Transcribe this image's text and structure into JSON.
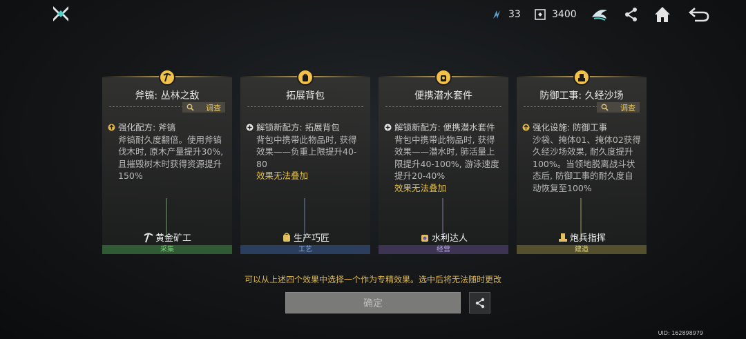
{
  "topbar": {
    "logo_icon": "crossed-blades-logo",
    "energy_count": "33",
    "coin_count": "3400"
  },
  "cards": [
    {
      "title": "斧镐: 丛林之敌",
      "investigate": "调查",
      "prefix": "强化配方: 斧镐",
      "body": "斧镐耐久度翻倍。使用斧镐伐木时, 原木产量提升30%, 且摧毁树木时获得资源提升150%",
      "warn": "",
      "role": "黄金矿工",
      "category": "采集",
      "category_color": "#2f5a34",
      "category_text_color": "#7ecf7c"
    },
    {
      "title": "拓展背包",
      "investigate": "",
      "prefix": "解锁新配方: 拓展背包",
      "body": "背包中携带此物品时, 获得效果——负重上限提升40-80",
      "warn": "效果无法叠加",
      "role": "生产巧匠",
      "category": "工艺",
      "category_color": "#2c3e5e",
      "category_text_color": "#8fb0e6"
    },
    {
      "title": "便携潜水套件",
      "investigate": "",
      "prefix": "解锁新配方: 便携潜水套件",
      "body": "背包中携带此物品时, 获得效果——潜水时, 肺活量上限提升40-100%, 游泳速度提升20-40%",
      "warn": "效果无法叠加",
      "role": "水利达人",
      "category": "经营",
      "category_color": "#3d3454",
      "category_text_color": "#b7a6e0"
    },
    {
      "title": "防御工事: 久经沙场",
      "investigate": "调查",
      "prefix": "强化设施: 防御工事",
      "body": "沙袋、掩体01、掩体02获得久经沙场效果, 耐久度提升100%。当领地脱离战斗状态后, 防御工事的耐久度自动恢复至100%",
      "warn": "",
      "role": "炮兵指挥",
      "category": "建造",
      "category_color": "#54502e",
      "category_text_color": "#e0d48a"
    }
  ],
  "hint": "可以从上述四个效果中选择一个作为专精效果。选中后将无法随时更改",
  "confirm_label": "确定",
  "uid": "UID: 162898979",
  "colors": {
    "accent_gold": "#e0b84a",
    "card_bg": "#2e2f2e"
  }
}
